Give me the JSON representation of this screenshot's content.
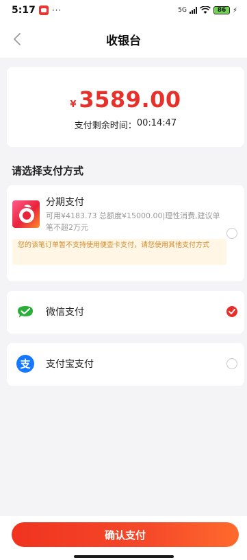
{
  "status_bar": {
    "time": "5:17",
    "dots": "···",
    "network": "5G",
    "battery": "86"
  },
  "nav": {
    "title": "收银台"
  },
  "payment": {
    "currency": "¥",
    "amount": "3589.00",
    "timer_label": "支付剩余时间：",
    "timer_value": "00:14:47"
  },
  "section_title": "请选择支付方式",
  "methods": [
    {
      "name": "分期支付",
      "desc": "可用¥4183.73 总额度¥15000.00|理性消费,建议单笔不超2万元",
      "notice": "您的该笔订单暂不支持使用便壶卡支付，请您使用其他支付方式",
      "selected": false
    },
    {
      "name": "微信支付",
      "selected": true
    },
    {
      "name": "支付宝支付",
      "selected": false
    }
  ],
  "confirm_label": "确认支付",
  "colors": {
    "accent": "#e8302a",
    "notice_bg": "#fff6e6",
    "notice_text": "#d08a2a",
    "wechat": "#2aae3a",
    "alipay": "#1677ff"
  }
}
